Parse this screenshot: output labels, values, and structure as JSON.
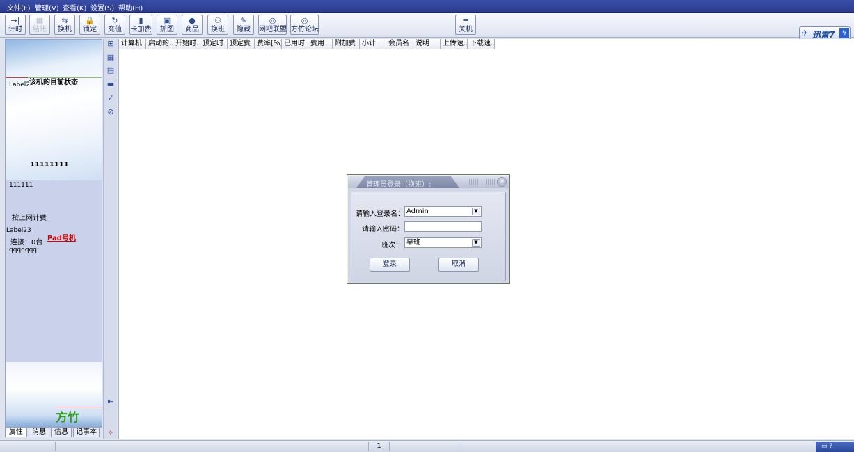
{
  "menu": [
    "文件(F)",
    "管理(V)",
    "查看(K)",
    "设置(S)",
    "帮助(H)"
  ],
  "toolbar": {
    "buttons": [
      {
        "label": "计时",
        "icon": "→|"
      },
      {
        "label": "结账",
        "icon": "▦"
      },
      {
        "label": "换机",
        "icon": "⇆"
      },
      {
        "label": "锁定",
        "icon": "🔒"
      },
      {
        "label": "充值",
        "icon": "↻"
      },
      {
        "label": "卡加费",
        "icon": "▮"
      },
      {
        "label": "抓图",
        "icon": "▣"
      },
      {
        "label": "商品",
        "icon": "●"
      },
      {
        "label": "换班",
        "icon": "⚇"
      },
      {
        "label": "隐藏",
        "icon": "✎"
      },
      {
        "label": "网吧联盟",
        "icon": "◎"
      },
      {
        "label": "方竹论坛",
        "icon": "◎"
      },
      {
        "label": "关机",
        "icon": "≡"
      }
    ]
  },
  "brand": {
    "text": "迅雷7"
  },
  "left_panel": {
    "label2": "Label2",
    "status_title": "该机的目前状态",
    "big_number": "11111111",
    "small_number": "111111",
    "billing_mode": "按上网计费",
    "label23": "Label23",
    "connection": "连接：0台",
    "red_label": "Pad号机",
    "qq": "qqqqqqq",
    "logo_text": "方竹"
  },
  "left_tabs": [
    "属性",
    "消息",
    "信息",
    "记事本"
  ],
  "columns": [
    "计算机...",
    "启动的...",
    "开始时...",
    "预定时",
    "预定费",
    "费率[%]",
    "已用时",
    "费用",
    "附加费",
    "小计",
    "会员名",
    "说明",
    "上传速...",
    "下载速..."
  ],
  "dialog": {
    "title": "管理员登录（换班）:",
    "username_label": "请输入登录名：",
    "username_value": "Admin",
    "password_label": "请输入密码：",
    "shift_label": "班次：",
    "shift_value": "早班",
    "login_button": "登录",
    "cancel_button": "取消"
  },
  "status_bar": {
    "page": "1"
  }
}
